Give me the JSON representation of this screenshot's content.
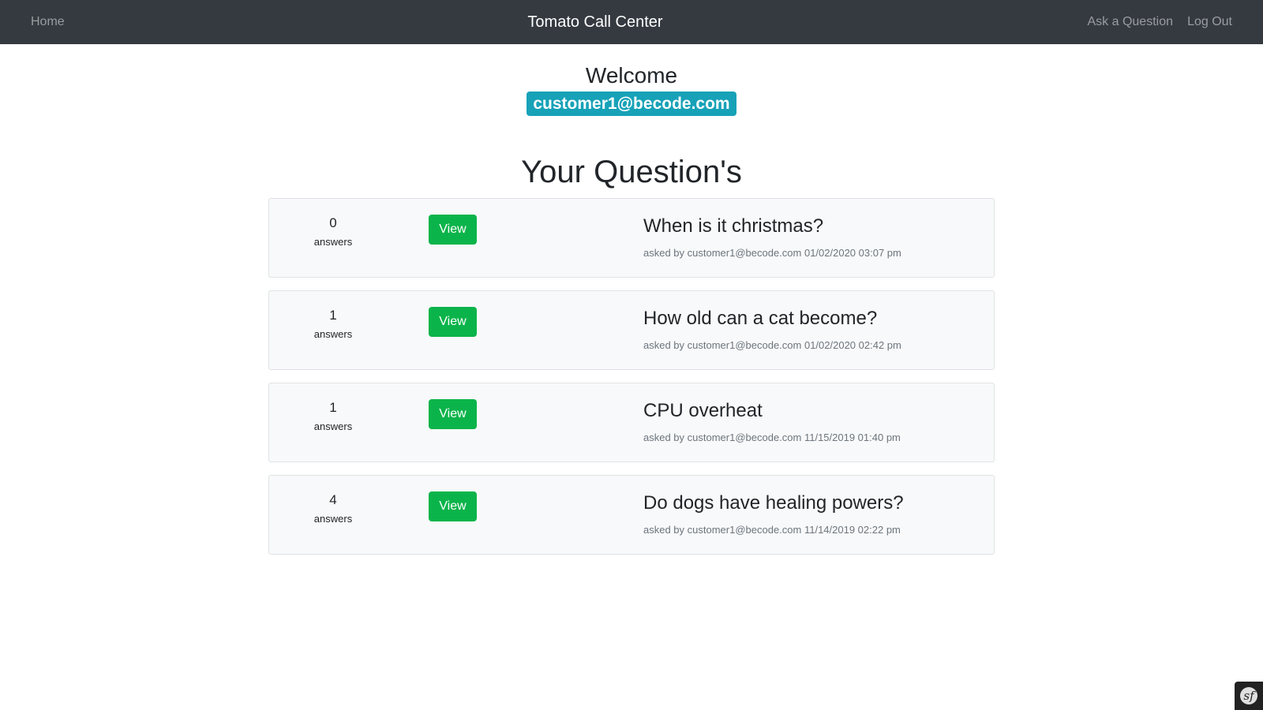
{
  "navbar": {
    "home_label": "Home",
    "brand": "Tomato Call Center",
    "ask_label": "Ask a Question",
    "logout_label": "Log Out"
  },
  "welcome": {
    "heading": "Welcome",
    "email": "customer1@becode.com"
  },
  "questions_section": {
    "title": "Your Question's",
    "answers_label": "answers",
    "view_label": "View",
    "items": [
      {
        "count": "0",
        "title": "When is it christmas?",
        "meta": "asked by customer1@becode.com 01/02/2020 03:07 pm"
      },
      {
        "count": "1",
        "title": "How old can a cat become?",
        "meta": "asked by customer1@becode.com 01/02/2020 02:42 pm"
      },
      {
        "count": "1",
        "title": "CPU overheat",
        "meta": "asked by customer1@becode.com 11/15/2019 01:40 pm"
      },
      {
        "count": "4",
        "title": "Do dogs have healing powers?",
        "meta": "asked by customer1@becode.com 11/14/2019 02:22 pm"
      }
    ]
  },
  "debug_toolbar": {
    "icon": "symfony-icon",
    "glyph": "sf"
  },
  "colors": {
    "navbar_bg": "#343a40",
    "badge_bg": "#17a2b8",
    "view_button_bg": "#0bb44a",
    "card_bg": "#f8f9fa"
  }
}
